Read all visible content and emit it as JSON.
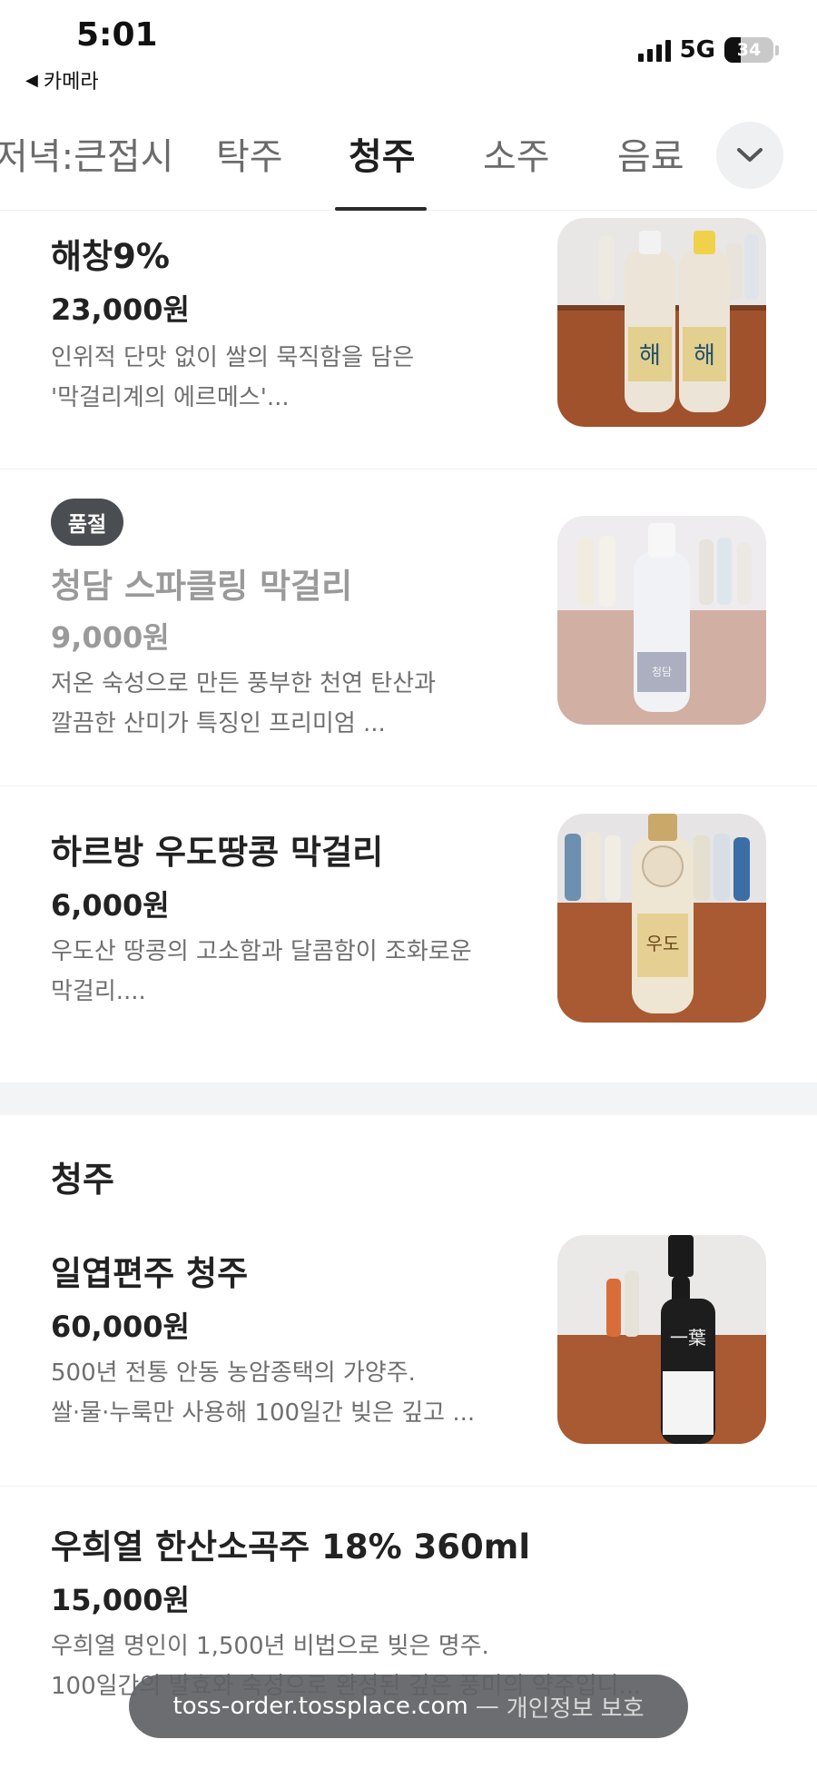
{
  "status_bar": {
    "time": "5:01",
    "back_app_label": "카메라",
    "network": "5G",
    "battery_pct": "34",
    "battery_level": 0.34
  },
  "tabs": [
    {
      "label": "저녁:큰접시",
      "active": false
    },
    {
      "label": "탁주",
      "active": false
    },
    {
      "label": "청주",
      "active": true
    },
    {
      "label": "소주",
      "active": false
    },
    {
      "label": "음료",
      "active": false
    }
  ],
  "items": [
    {
      "name": "해창9%",
      "price": "23,000원",
      "desc_line1": "인위적 단맛 없이 쌀의 묵직함을 담은",
      "desc_line2": "'막걸리계의 에르메스'..."
    },
    {
      "badge": "품절",
      "name": "청담 스파클링 막걸리",
      "price": "9,000원",
      "desc_line1": "저온 숙성으로 만든 풍부한 천연 탄산과",
      "desc_line2": "깔끔한 산미가 특징인 프리미엄 ..."
    },
    {
      "name": "하르방 우도땅콩 막걸리",
      "price": "6,000원",
      "desc_line1": "우도산 땅콩의 고소함과 달콤함이 조화로운",
      "desc_line2": "막걸리...."
    }
  ],
  "section": {
    "title": "청주"
  },
  "section_items": [
    {
      "name": "일엽편주 청주",
      "price": "60,000원",
      "desc_line1": "500년 전통 안동 농암종택의 가양주.",
      "desc_line2": "쌀·물·누룩만 사용해 100일간 빚은 깊고 ..."
    },
    {
      "name": "우희열 한산소곡주 18% 360ml",
      "price": "15,000원",
      "desc_line1": "우희열 명인이 1,500년 비법으로 빚은 명주.",
      "desc_line2": "100일간의 발효와 숙성으로 완성된 깊은 풍미의 약주입니..."
    }
  ],
  "url_bar": {
    "domain": "toss-order.tossplace.com",
    "separator": "—",
    "note": "개인정보 보호"
  },
  "colors": {
    "accent": "#2a2a2a",
    "badge_bg": "#4a4d52",
    "section_gap": "#f3f4f6"
  }
}
